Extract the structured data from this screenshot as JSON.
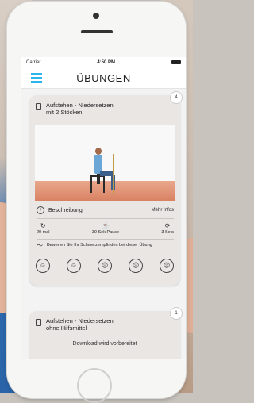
{
  "status_bar": {
    "carrier": "Carrier",
    "wifi": "wifi-icon",
    "time": "4:50 PM",
    "battery": "battery-icon"
  },
  "nav": {
    "title": "ÜBUNGEN",
    "menu": "hamburger-icon"
  },
  "cards": [
    {
      "badge": "4",
      "title": "Aufstehen - Niedersetzen",
      "subtitle": "mit 2 Stöcken",
      "description_label": "Beschreibung",
      "more_info": "Mehr Infos",
      "stats": [
        {
          "icon": "repeat-icon",
          "label": "20 mal"
        },
        {
          "icon": "cup-icon",
          "label": "30 Sek Pause"
        },
        {
          "icon": "sets-icon",
          "label": "3 Sets"
        }
      ],
      "rating_prompt": "Bewerten Sie Ihr Schmerzempfinden bei dieser Übung",
      "faces": [
        "face-1-icon",
        "face-2-icon",
        "face-3-icon",
        "face-4-icon",
        "face-5-icon"
      ]
    },
    {
      "badge": "1",
      "title": "Aufstehen - Niedersetzen",
      "subtitle": "ohne Hilfsmittel",
      "loading": "Download wird vorbereitet"
    }
  ],
  "colors": {
    "accent": "#2bb5ea"
  }
}
